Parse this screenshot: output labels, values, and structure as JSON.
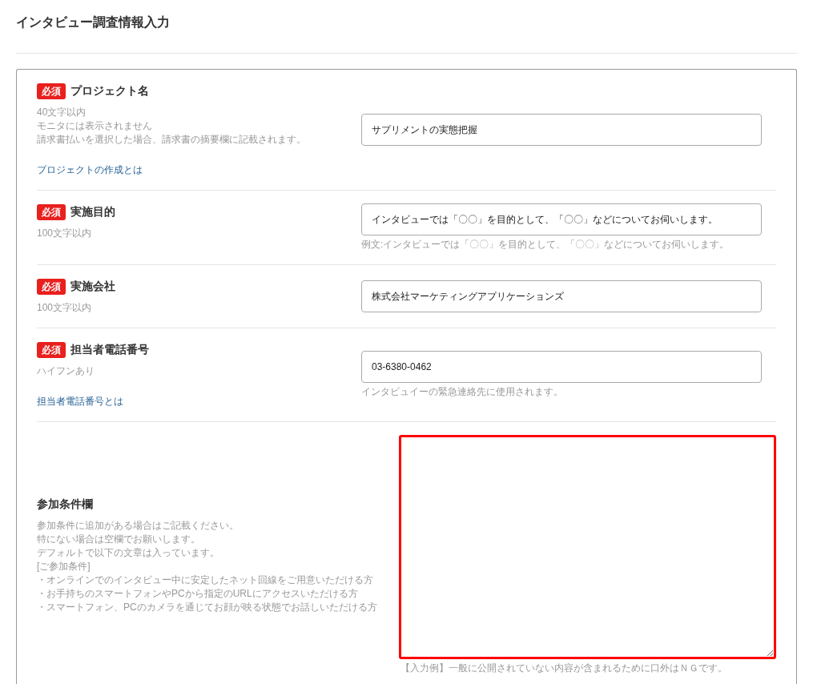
{
  "page_title": "インタビュー調査情報入力",
  "fields": [
    {
      "kind": "input",
      "label": "プロジェクト名",
      "required_badge": "必須",
      "notes": [
        "40文字以内",
        "モニタには表示されません",
        "請求書払いを選択した場合、請求書の摘要欄に記載されます。"
      ],
      "link": "プロジェクトの作成とは",
      "value": "サプリメントの実態把握"
    },
    {
      "kind": "input",
      "label": "実施目的",
      "required_badge": "必須",
      "notes": [
        "100文字以内"
      ],
      "value": "インタビューでは「〇〇」を目的として、「〇〇」などについてお伺いします。",
      "hint": "例文:インタビューでは「〇〇」を目的として、「〇〇」などについてお伺いします。"
    },
    {
      "kind": "input",
      "label": "実施会社",
      "required_badge": "必須",
      "notes": [
        "100文字以内"
      ],
      "value": "株式会社マーケティングアプリケーションズ"
    },
    {
      "kind": "input",
      "label": "担当者電話番号",
      "required_badge": "必須",
      "notes": [
        "ハイフンあり"
      ],
      "link": "担当者電話番号とは",
      "value": "03-6380-0462",
      "hint": "インタビュイーの緊急連絡先に使用されます。"
    },
    {
      "kind": "textarea",
      "label": "参加条件欄",
      "notes": [
        "参加条件に追加がある場合はご記載ください。",
        "特にない場合は空欄でお願いします。",
        "デフォルトで以下の文章は入っています。",
        "[ご参加条件]",
        "・オンラインでのインタビュー中に安定したネット回線をご用意いただける方",
        "・お手持ちのスマートフォンやPCから指定のURLにアクセスいただける方",
        "・スマートフォン、PCのカメラを通じてお顔が映る状態でお話しいただける方"
      ],
      "highlighted": true,
      "hint": "【入力例】一般に公開されていない内容が含まれるために口外はＮＧです。"
    }
  ]
}
